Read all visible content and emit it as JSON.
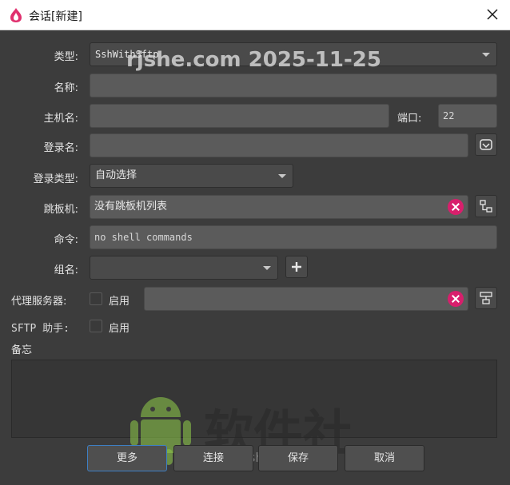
{
  "window": {
    "title": "会话[新建]"
  },
  "form": {
    "type_label": "类型:",
    "type_value": "SshWithSftp",
    "name_label": "名称:",
    "name_value": "",
    "host_label": "主机名:",
    "host_value": "",
    "port_label": "端口:",
    "port_value": "22",
    "login_label": "登录名:",
    "login_value": "",
    "login_type_label": "登录类型:",
    "login_type_value": "自动选择",
    "jump_label": "跳板机:",
    "jump_value": "没有跳板机列表",
    "command_label": "命令:",
    "command_value": "no shell commands",
    "group_label": "组名:",
    "group_value": "",
    "proxy_label": "代理服务器:",
    "proxy_enable_label": "启用",
    "proxy_value": "",
    "sftp_label": "SFTP 助手:",
    "sftp_enable_label": "启用",
    "memo_label": "备忘"
  },
  "buttons": {
    "more": "更多",
    "connect": "连接",
    "save": "保存",
    "cancel": "取消"
  },
  "watermarks": {
    "top": "rjshe.com 2025-11-25",
    "brand": "软件社",
    "bottom": "rjshe.com"
  },
  "colors": {
    "accent_pink": "#d81f6c",
    "focus_blue": "#3d7fc4",
    "android_green": "#8bc34a"
  }
}
